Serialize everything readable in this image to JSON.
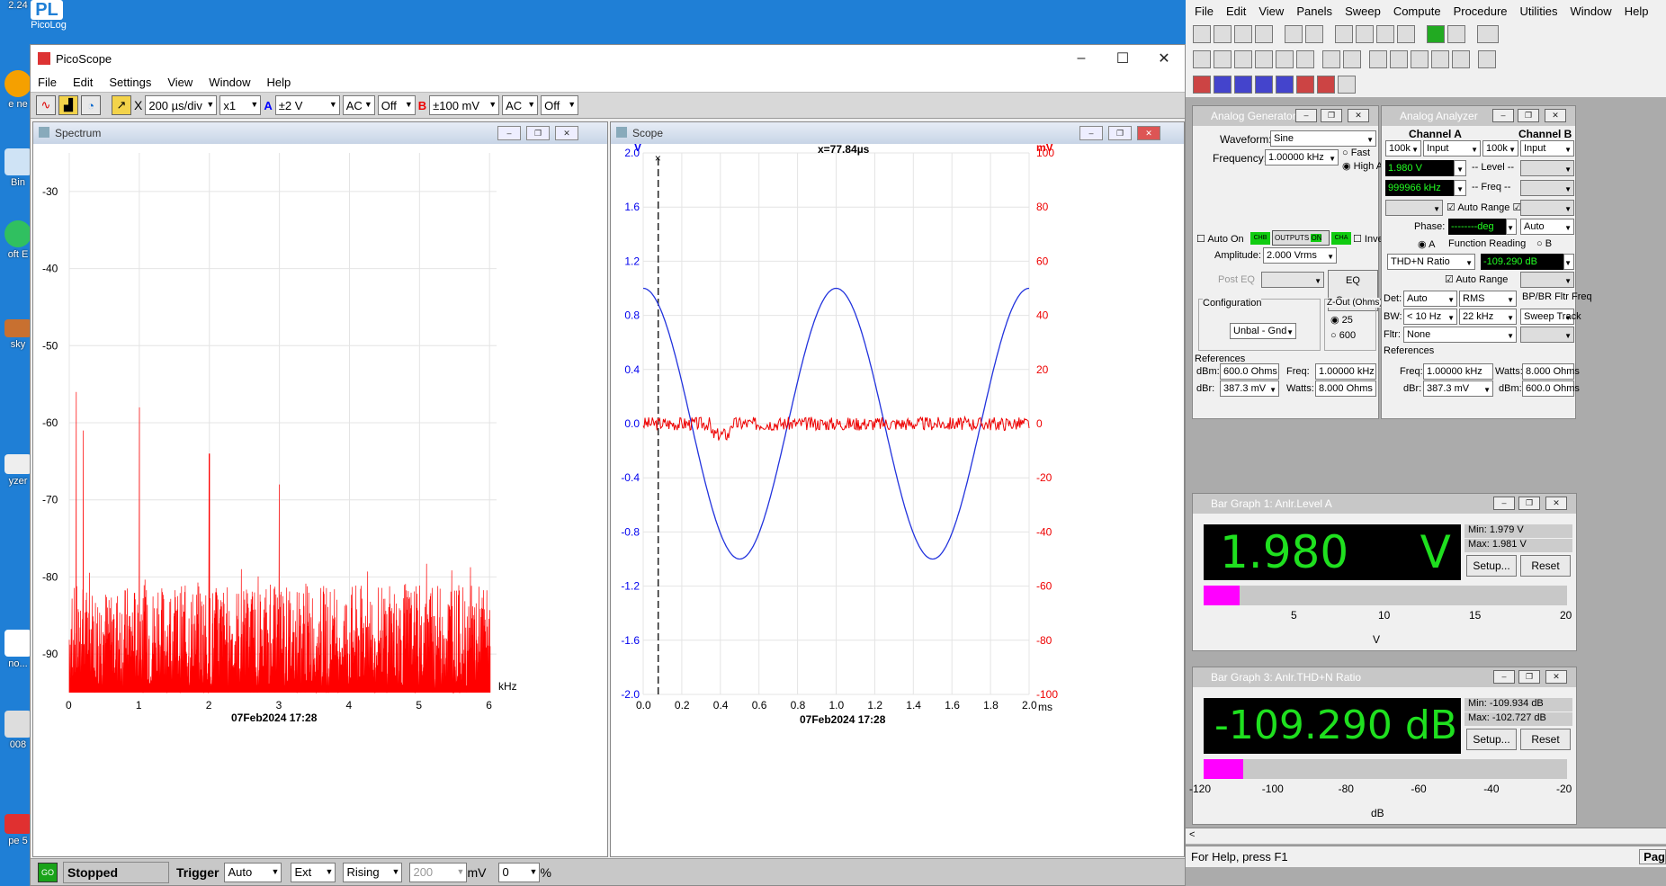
{
  "desktop": {
    "icons": [
      {
        "label": "2.24"
      },
      {
        "label": "PicoLog"
      },
      {
        "label": "e\nne"
      },
      {
        "label": "Bin"
      },
      {
        "label": "oft\nE"
      },
      {
        "label": "sky"
      },
      {
        "label": "yzer"
      },
      {
        "label": "no..."
      },
      {
        "label": "008"
      },
      {
        "label": "pe 5"
      }
    ]
  },
  "pico": {
    "title": "PicoScope",
    "menu": [
      "File",
      "Edit",
      "Settings",
      "View",
      "Window",
      "Help"
    ],
    "toolbar": {
      "timebase": "200 µs/div",
      "mult": "x1",
      "chA_label": "A",
      "chA_range": "±2 V",
      "chA_coupling": "AC",
      "chA_filter": "Off",
      "chB_label": "B",
      "chB_range": "±100 mV",
      "chB_coupling": "AC",
      "chB_filter": "Off"
    },
    "spectrum": {
      "title": "Spectrum",
      "x_unit": "kHz",
      "date": "07Feb2024  17:28"
    },
    "scope": {
      "title": "Scope",
      "cursor": "x=77.84µs",
      "left_unit": "V",
      "right_unit": "mV",
      "x_unit": "ms",
      "date": "07Feb2024  17:28"
    },
    "status": {
      "state": "Stopped",
      "go": "GO",
      "trigger_label": "Trigger",
      "trigger_mode": "Auto",
      "trigger_src": "Ext",
      "trigger_edge": "Rising",
      "trigger_level": "200",
      "level_unit": "mV",
      "pre": "0",
      "pre_unit": "%"
    }
  },
  "analyzer": {
    "menu": [
      "File",
      "Edit",
      "View",
      "Panels",
      "Sweep",
      "Compute",
      "Procedure",
      "Utilities",
      "Window",
      "Help"
    ],
    "generator": {
      "title": "Analog Generator",
      "waveform_label": "Waveform:",
      "waveform": "Sine",
      "freq_label": "Frequency:",
      "freq": "1.00000 kHz",
      "fast": "Fast",
      "high_acc": "High Acc.",
      "auto_on": "Auto On",
      "chb": "CHB",
      "outputs": "OUTPUTS",
      "on": "ON",
      "cha": "CHA",
      "invert": "Invert",
      "amp_label": "Amplitude:",
      "amp": "2.000  Vrms",
      "post_eq": "Post EQ",
      "eq_curve": "EQ Curve...",
      "config_label": "Configuration",
      "config": "Unbal - Gnd",
      "zout_label": "Z-Out (Ohms)",
      "z25": "25",
      "z600": "600",
      "refs": "References",
      "dbm_label": "dBm:",
      "dbm": "600.0  Ohms",
      "dbr_label": "dBr:",
      "dbr": "387.3  mV",
      "freq2_label": "Freq:",
      "freq2": "1.00000 kHz",
      "watts_label": "Watts:",
      "watts": "8.000   Ohms"
    },
    "anlr": {
      "title": "Analog Analyzer",
      "chA": "Channel A",
      "chB": "Channel B",
      "rangeA": "100k",
      "inA": "Input",
      "rangeB": "100k",
      "inB": "Input",
      "levelA": "1.980  V",
      "level_label": "-- Level --",
      "freqA": "999966 kHz",
      "freq_label": "-- Freq --",
      "auto_range": "Auto Range",
      "phase_label": "Phase:",
      "phase": "--------deg",
      "phase_mode": "Auto",
      "fr_a": "A",
      "fr_label": "Function Reading",
      "fr_b": "B",
      "fr_func": "THD+N Ratio",
      "fr_val": "-109.290 dB",
      "auto_range2": "Auto Range",
      "det_label": "Det:",
      "det": "Auto",
      "det2": "RMS",
      "bp": "BP/BR Fltr Freq",
      "bw_label": "BW:",
      "bw1": "< 10 Hz",
      "bw2": "22 kHz",
      "sweep_track": "Sweep Track",
      "fltr_label": "Fltr:",
      "fltr": "None",
      "refs": "References",
      "freq_label2": "Freq:",
      "freq2": "1.00000 kHz",
      "watts_label": "Watts:",
      "watts": "8.000   Ohms",
      "dbr_label": "dBr:",
      "dbr": "387.3  mV",
      "dbm_label": "dBm:",
      "dbm": "600.0  Ohms"
    },
    "bar1": {
      "title": "Bar Graph 1: Anlr.Level A",
      "value": "1.980     V",
      "min": "Min: 1.979   V",
      "max": "Max: 1.981   V",
      "setup": "Setup...",
      "reset": "Reset",
      "fill": 0.1,
      "ticks": [
        "5",
        "10",
        "15",
        "20"
      ],
      "unit": "V"
    },
    "bar3": {
      "title": "Bar Graph 3: Anlr.THD+N Ratio",
      "value": "-109.290 dB",
      "min": "Min: -109.934 dB",
      "max": "Max: -102.727 dB",
      "setup": "Setup...",
      "reset": "Reset",
      "fill": 0.11,
      "ticks": [
        "-120",
        "-100",
        "-80",
        "-60",
        "-40",
        "-20"
      ],
      "unit": "dB"
    },
    "status": "For Help, press F1",
    "status_right": "Pag"
  },
  "chart_data": [
    {
      "type": "line",
      "title": "Spectrum",
      "ylabel": "",
      "xlabel": "kHz",
      "xlim": [
        0,
        6.1
      ],
      "ylim": [
        -95,
        -25
      ],
      "x_ticks": [
        "0",
        "1",
        "2",
        "3",
        "4",
        "5",
        "6"
      ],
      "y_ticks": [
        "-30",
        "-40",
        "-50",
        "-60",
        "-70",
        "-80",
        "-90"
      ],
      "series": [
        {
          "color": "#ff0000",
          "values": "noise floor about -80 to -95 with peaks at 0.1 kHz (-56), 0.2 kHz (-61), 1 kHz (-58), 2 kHz (-64), 3 kHz (-68)"
        }
      ]
    },
    {
      "type": "line",
      "title": "",
      "x": [
        0,
        0.25,
        0.5,
        0.75,
        1,
        1.25,
        1.5,
        1.75,
        2
      ],
      "xlim": [
        0,
        2
      ],
      "xlabel": "ms",
      "y_left_ticks": [
        "2.0",
        "1.6",
        "1.2",
        "0.8",
        "0.4",
        "0.0",
        "-0.4",
        "-0.8",
        "-1.2",
        "-1.6",
        "-2.0"
      ],
      "y_right_ticks": [
        "100",
        "80",
        "60",
        "40",
        "20",
        "0",
        "-20",
        "-40",
        "-60",
        "-80",
        "-100"
      ],
      "series": [
        {
          "name": "A",
          "unit": "V",
          "color": "#2233dd",
          "values": [
            1.0,
            0,
            -1.0,
            0,
            1.0,
            0,
            -1.0,
            0,
            1.0
          ]
        },
        {
          "name": "B",
          "unit": "mV",
          "color": "#ee0000",
          "values": [
            0,
            -2,
            -3,
            -1,
            0,
            -2,
            -1,
            -2,
            0
          ]
        }
      ]
    }
  ]
}
